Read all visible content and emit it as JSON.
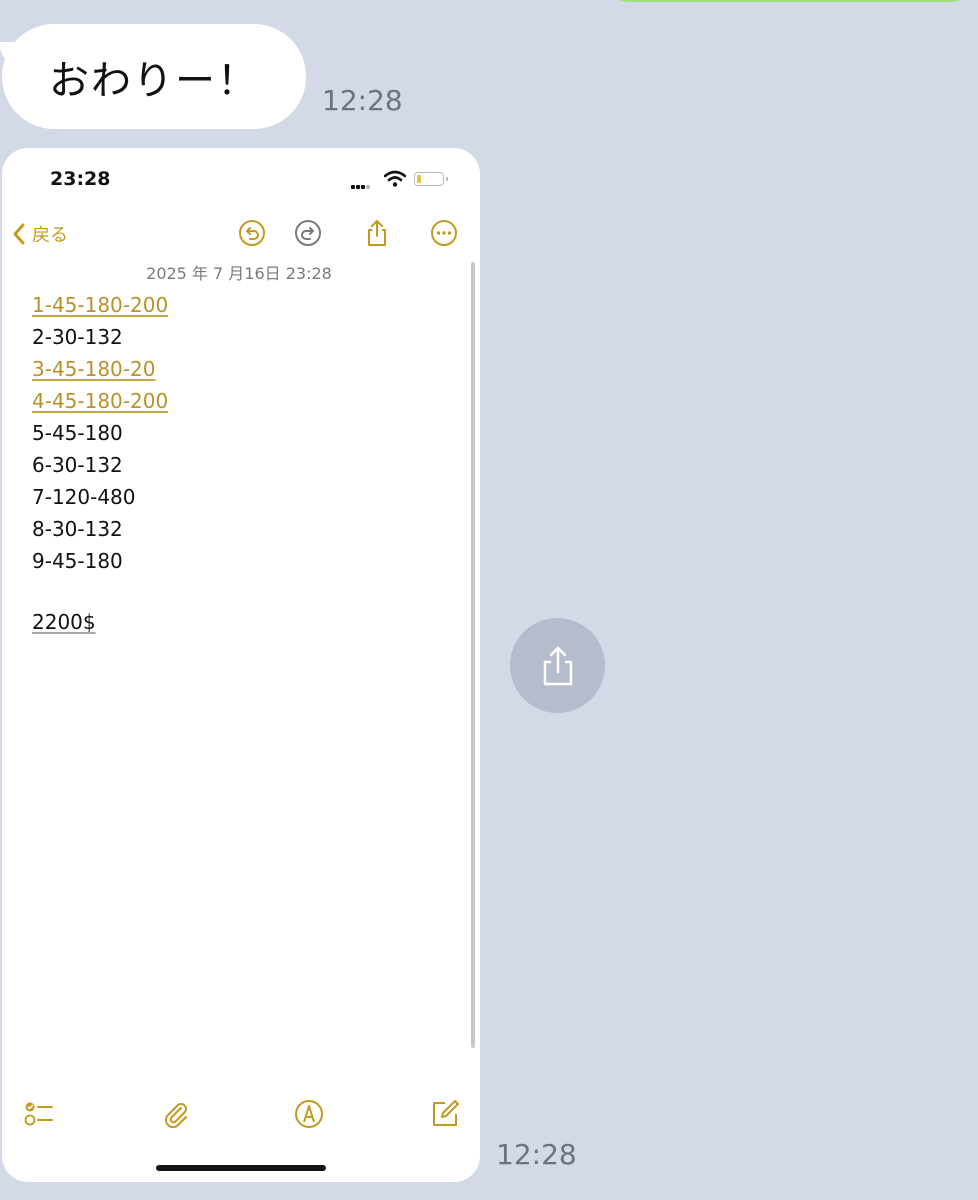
{
  "chat": {
    "message_text": "おわりー！",
    "message_time": "12:28",
    "image_time": "12:28"
  },
  "screenshot": {
    "status_time": "23:28",
    "back_label": "戻る",
    "note_date": "2025 年 7 月16日 23:28",
    "lines": [
      {
        "text": "1-45-180-200",
        "linked": true
      },
      {
        "text": "2-30-132",
        "linked": false
      },
      {
        "text": "3-45-180-20",
        "linked": true
      },
      {
        "text": "4-45-180-200",
        "linked": true
      },
      {
        "text": "5-45-180",
        "linked": false
      },
      {
        "text": "6-30-132",
        "linked": false
      },
      {
        "text": "7-120-480",
        "linked": false
      },
      {
        "text": "8-30-132",
        "linked": false
      },
      {
        "text": "9-45-180",
        "linked": false
      }
    ],
    "total": "2200$",
    "icons": {
      "undo": "undo-icon",
      "redo": "redo-icon",
      "share": "share-icon",
      "more": "more-icon",
      "checklist": "checklist-icon",
      "attach": "paperclip-icon",
      "markup": "pen-tip-icon",
      "compose": "compose-icon"
    },
    "accent_color": "#c29a1e"
  },
  "colors": {
    "chat_background": "#d3d9e6",
    "bubble": "#ffffff",
    "share_circle": "#b5bccb"
  }
}
